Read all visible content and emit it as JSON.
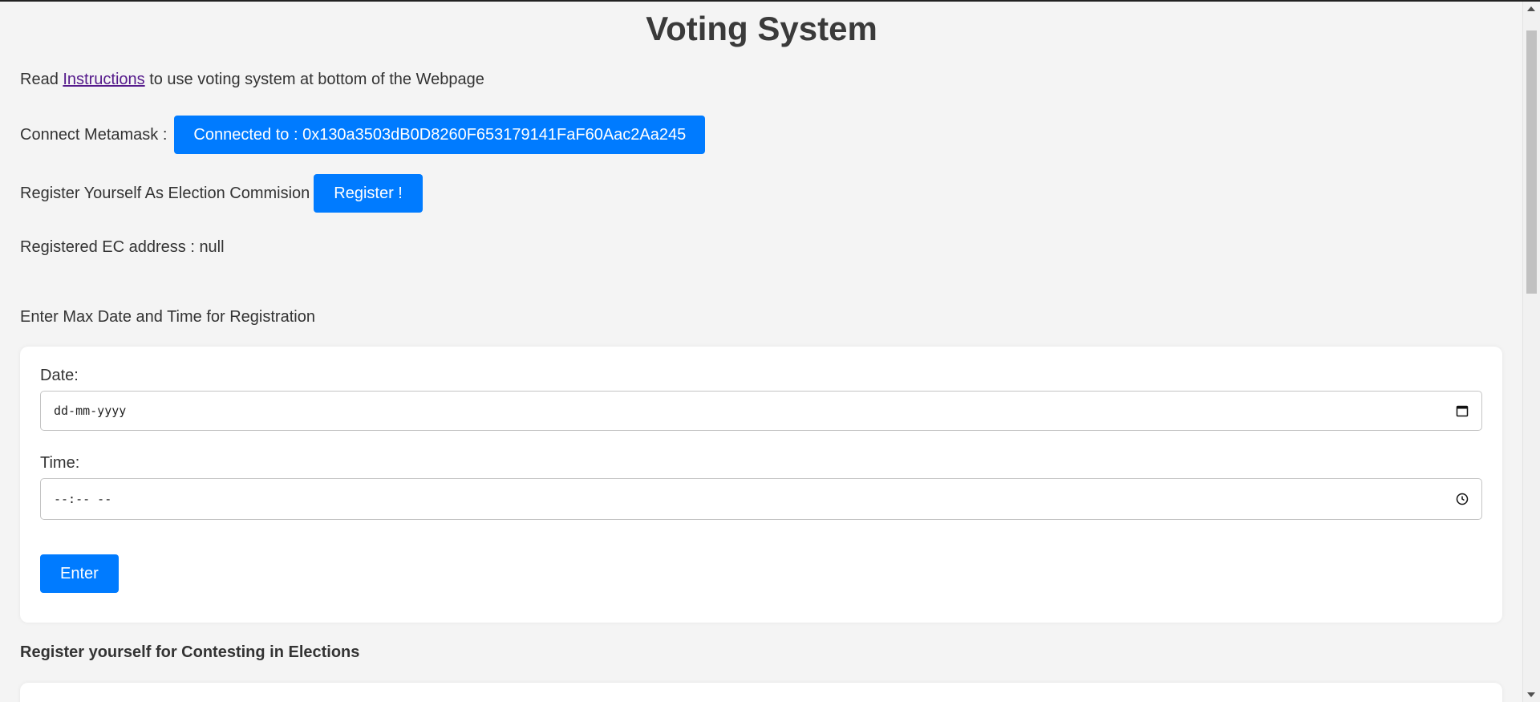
{
  "page": {
    "title": "Voting System"
  },
  "instructions_line": {
    "prefix": "Read ",
    "link": "Instructions",
    "suffix": " to use voting system at bottom of the Webpage"
  },
  "metamask": {
    "label": "Connect Metamask :",
    "button": "Connected to : 0x130a3503dB0D8260F653179141FaF60Aac2Aa245"
  },
  "ec_register": {
    "label": "Register Yourself As Election Commision",
    "button": "Register !"
  },
  "ec_address": {
    "text": "Registered EC address : null"
  },
  "registration_deadline": {
    "heading": "Enter Max Date and Time for Registration",
    "date_label": "Date:",
    "date_placeholder": "dd-mm-yyyy",
    "time_label": "Time:",
    "time_placeholder": "--:-- --",
    "submit": "Enter"
  },
  "contest_section": {
    "heading": "Register yourself for Contesting in Elections"
  },
  "colors": {
    "accent": "#007bff",
    "background": "#f4f4f4",
    "card": "#ffffff",
    "link_visited": "#551a8b"
  },
  "icons": {
    "date_field": "calendar-icon",
    "time_field": "clock-icon"
  }
}
